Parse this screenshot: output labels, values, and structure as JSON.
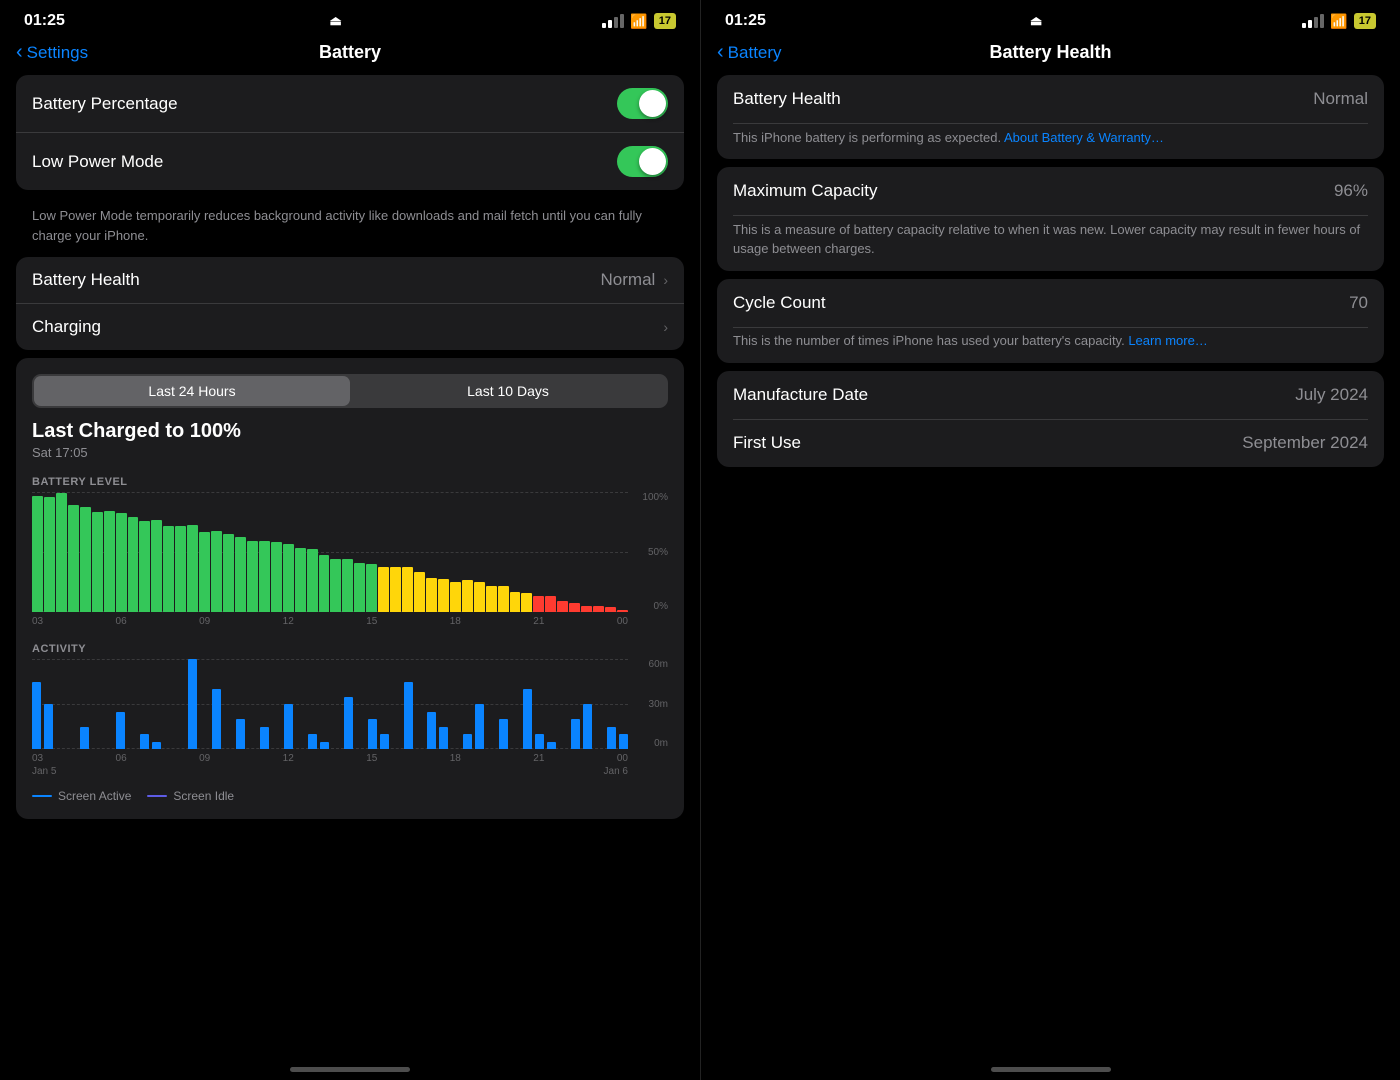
{
  "left_panel": {
    "status_bar": {
      "time": "01:25",
      "battery_level": "17"
    },
    "nav": {
      "back_label": "Settings",
      "title": "Battery"
    },
    "toggles": [
      {
        "label": "Battery Percentage",
        "enabled": true
      },
      {
        "label": "Low Power Mode",
        "enabled": true
      }
    ],
    "low_power_description": "Low Power Mode temporarily reduces background activity like downloads and mail fetch until you can fully charge your iPhone.",
    "rows": [
      {
        "label": "Battery Health",
        "value": "Normal",
        "has_chevron": true
      },
      {
        "label": "Charging",
        "value": "",
        "has_chevron": true
      }
    ],
    "chart": {
      "segment_left": "Last 24 Hours",
      "segment_right": "Last 10 Days",
      "main_title": "Last Charged to 100%",
      "subtitle": "Sat 17:05",
      "battery_label": "BATTERY LEVEL",
      "activity_label": "ACTIVITY",
      "y_labels_battery": [
        "100%",
        "50%",
        "0%"
      ],
      "y_labels_activity": [
        "60m",
        "30m",
        "0m"
      ],
      "x_labels": [
        "03",
        "06",
        "09",
        "12",
        "15",
        "18",
        "21",
        "00"
      ],
      "date_labels_left": "Jan 5",
      "date_labels_right": "Jan 6",
      "legend": [
        {
          "label": "Screen Active",
          "color": "#0a84ff"
        },
        {
          "label": "Screen Idle",
          "color": "#5e5ce6"
        }
      ]
    }
  },
  "right_panel": {
    "status_bar": {
      "time": "01:25",
      "battery_level": "17"
    },
    "nav": {
      "back_label": "Battery",
      "title": "Battery Health"
    },
    "sections": [
      {
        "rows": [
          {
            "label": "Battery Health",
            "value": "Normal"
          }
        ],
        "description": "This iPhone battery is performing as expected.",
        "link_text": "About Battery & Warranty…"
      },
      {
        "rows": [
          {
            "label": "Maximum Capacity",
            "value": "96%"
          }
        ],
        "description": "This is a measure of battery capacity relative to when it was new. Lower capacity may result in fewer hours of usage between charges."
      },
      {
        "rows": [
          {
            "label": "Cycle Count",
            "value": "70"
          }
        ],
        "description": "This is the number of times iPhone has used your battery's capacity.",
        "link_text": "Learn more…"
      },
      {
        "rows": [
          {
            "label": "Manufacture Date",
            "value": "July 2024"
          },
          {
            "label": "First Use",
            "value": "September 2024"
          }
        ]
      }
    ]
  }
}
